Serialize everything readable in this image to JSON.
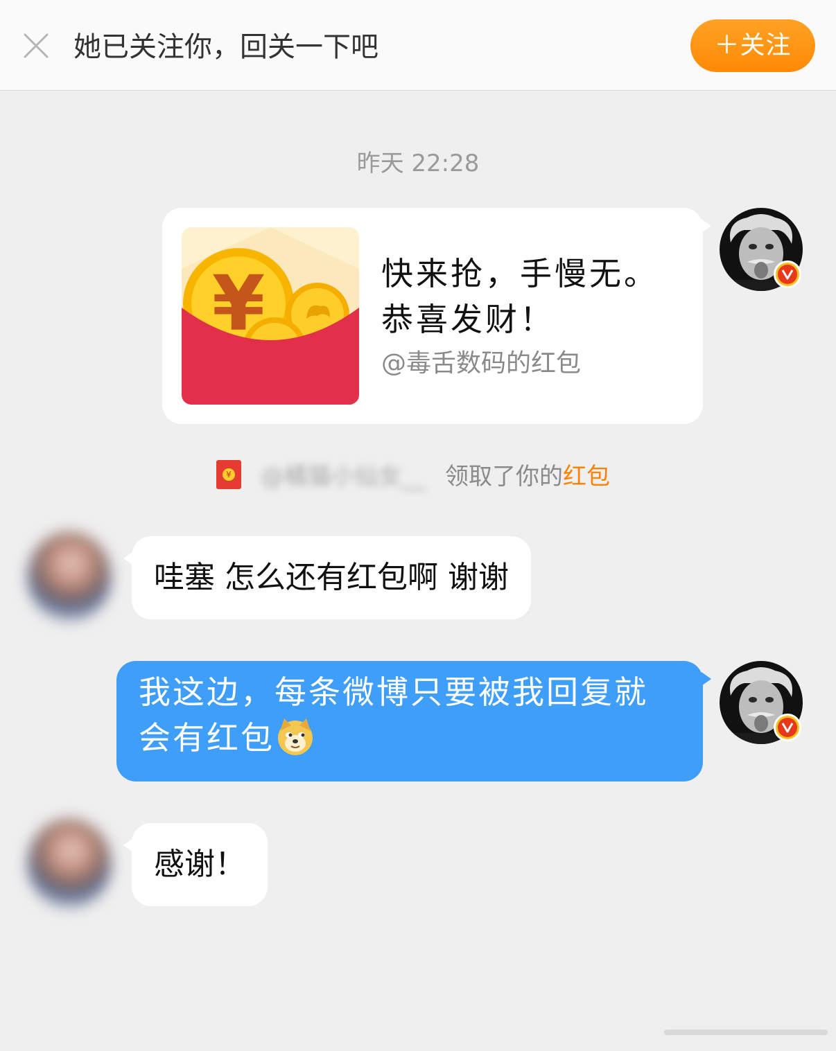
{
  "banner": {
    "close_icon": "close-icon",
    "message": "她已关注你，回关一下吧",
    "follow_label": "＋关注",
    "follow_color": "#ff9512"
  },
  "timestamp": "昨天 22:28",
  "messages": [
    {
      "type": "red_packet",
      "side": "right",
      "title": "快来抢，手慢无。恭喜发财！",
      "subtitle": "@毒舌数码的红包",
      "icon": "red-packet-icon"
    },
    {
      "type": "system_notice",
      "icon": "red-packet-small-icon",
      "user": "@橘猫小仙女__",
      "text": "领取了你的",
      "link": "红包",
      "link_color": "#ff8200"
    },
    {
      "type": "text",
      "side": "left",
      "text": "哇塞 怎么还有红包啊 谢谢"
    },
    {
      "type": "text",
      "side": "right",
      "text": "我这边，每条微博只要被我回复就会有红包",
      "emoji": "doge-emoji",
      "bubble_color": "#3f9ef7"
    },
    {
      "type": "text",
      "side": "left",
      "text": "感谢！"
    }
  ],
  "self_avatar": {
    "icon": "verified-v-badge-icon",
    "badge_label": "V"
  }
}
